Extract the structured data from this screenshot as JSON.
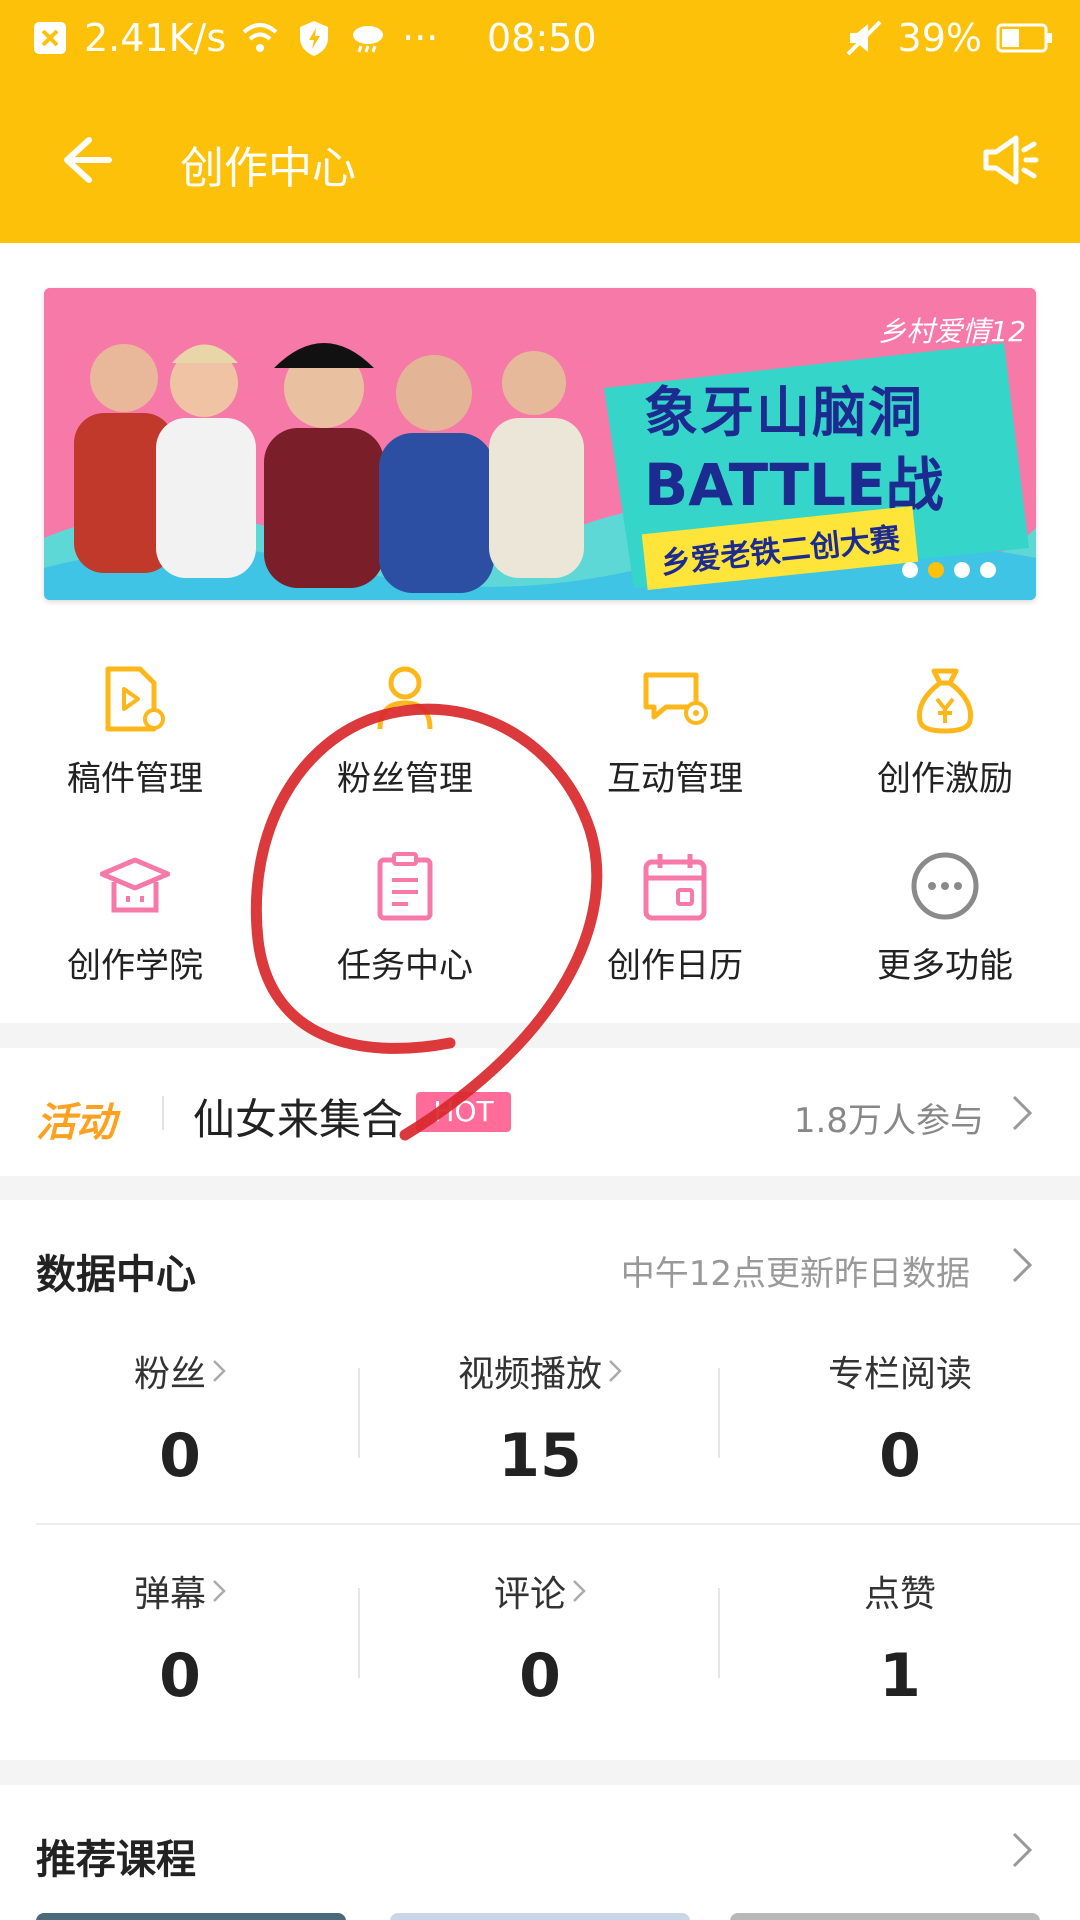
{
  "status_bar": {
    "speed": "2.41K/s",
    "more": "···",
    "time": "08:50",
    "battery": "39%"
  },
  "header": {
    "title": "创作中心"
  },
  "banner": {
    "headline_line1": "象牙山脑洞",
    "headline_line2": "BATTLE战",
    "subline": "乡爱老铁二创大赛",
    "corner_text": "乡村爱情12",
    "dots": 4,
    "active_dot": 2
  },
  "functions": [
    {
      "label": "稿件管理",
      "icon": "manuscript-icon"
    },
    {
      "label": "粉丝管理",
      "icon": "fans-icon"
    },
    {
      "label": "互动管理",
      "icon": "interaction-icon"
    },
    {
      "label": "创作激励",
      "icon": "money-bag-icon"
    },
    {
      "label": "创作学院",
      "icon": "academy-icon"
    },
    {
      "label": "任务中心",
      "icon": "clipboard-icon"
    },
    {
      "label": "创作日历",
      "icon": "calendar-icon"
    },
    {
      "label": "更多功能",
      "icon": "more-icon"
    }
  ],
  "activity": {
    "tag": "活动",
    "title": "仙女来集合",
    "badge": "HOT",
    "participants": "1.8万人参与"
  },
  "data_center": {
    "title": "数据中心",
    "note": "中午12点更新昨日数据",
    "stats": [
      {
        "label": "粉丝",
        "value": "0"
      },
      {
        "label": "视频播放",
        "value": "15"
      },
      {
        "label": "专栏阅读",
        "value": "0"
      },
      {
        "label": "弹幕",
        "value": "0"
      },
      {
        "label": "评论",
        "value": "0"
      },
      {
        "label": "点赞",
        "value": "1"
      }
    ]
  },
  "courses": {
    "title": "推荐课程"
  },
  "colors": {
    "header": "#FEC109",
    "accent_yellow": "#FEB71A",
    "accent_pink": "#F779A8",
    "annotation_red": "#D8282A"
  }
}
